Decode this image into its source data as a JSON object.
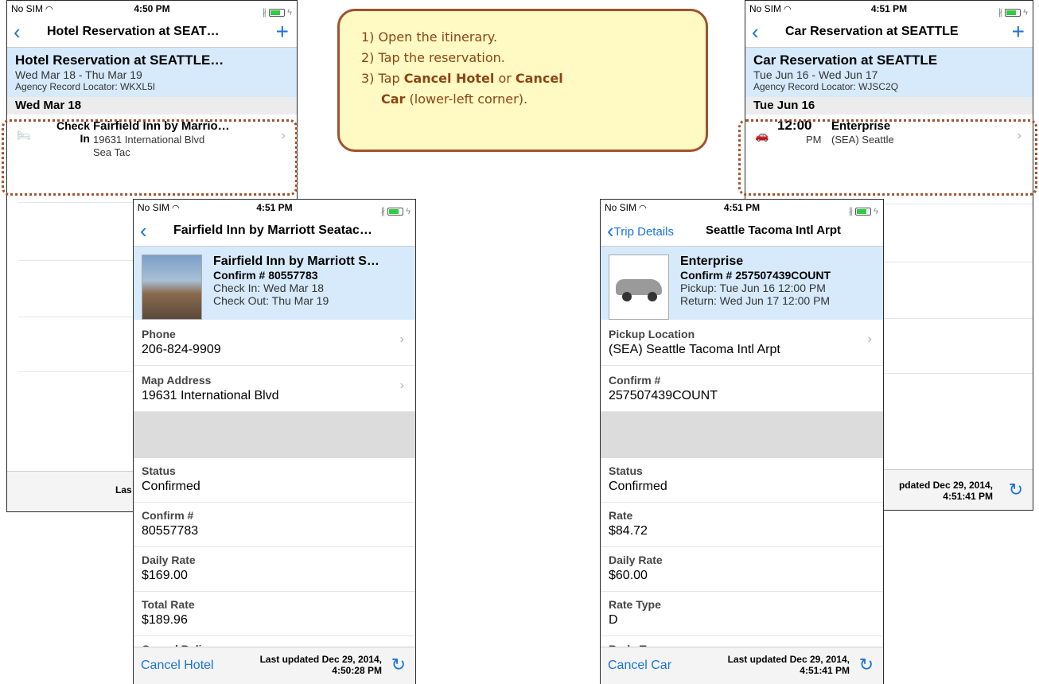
{
  "callout": {
    "step1": "1) Open the itinerary.",
    "step2": "2) Tap the reservation.",
    "step3_pre": "3) Tap ",
    "step3_b1": "Cancel Hotel",
    "step3_mid": " or ",
    "step3_b2": "Cancel",
    "step3_b2b": "Car",
    "step3_post": " (lower-left corner)."
  },
  "hotel_list": {
    "status": {
      "carrier": "No SIM",
      "time": "4:50 PM"
    },
    "nav_title": "Hotel Reservation at SEAT…",
    "header": {
      "title": "Hotel Reservation at SEATTLE…",
      "dates": "Wed Mar 18 - Thu Mar 19",
      "locator": "Agency Record Locator: WKXL5I"
    },
    "section": "Wed Mar 18",
    "row": {
      "label1": "Check",
      "label2": "In",
      "name": "Fairfield Inn by Marrio…",
      "addr1": "19631 International Blvd",
      "addr2": "Sea Tac"
    },
    "footer_partial": "Las"
  },
  "hotel_detail": {
    "status": {
      "carrier": "No SIM",
      "time": "4:51 PM"
    },
    "nav_title": "Fairfield Inn by Marriott Seatac…",
    "header": {
      "title": "Fairfield Inn by Marriott S…",
      "confirm": "Confirm # 80557783",
      "line1": "Check In: Wed Mar 18",
      "line2": "Check Out: Thu Mar 19"
    },
    "fields": [
      {
        "label": "Phone",
        "value": "206-824-9909"
      },
      {
        "label": "Map Address",
        "value": "19631 International Blvd"
      },
      {
        "label": "Status",
        "value": "Confirmed"
      },
      {
        "label": "Confirm #",
        "value": "80557783"
      },
      {
        "label": "Daily Rate",
        "value": "$169.00"
      },
      {
        "label": "Total Rate",
        "value": "$189.96"
      },
      {
        "label": "Cancel Policy",
        "value": ""
      }
    ],
    "footer": {
      "cancel": "Cancel Hotel",
      "updated1": "Last updated Dec 29, 2014,",
      "updated2": "4:50:28 PM"
    }
  },
  "car_list": {
    "status": {
      "carrier": "No SIM",
      "time": "4:51 PM"
    },
    "nav_title": "Car Reservation at SEATTLE",
    "header": {
      "title": "Car Reservation at SEATTLE",
      "dates": "Tue Jun 16 - Wed Jun 17",
      "locator": "Agency Record Locator: WJSC2Q"
    },
    "section": "Tue Jun 16",
    "row": {
      "time": "12:00",
      "ampm": "PM",
      "name": "Enterprise",
      "sub": "(SEA) Seattle"
    },
    "footer": {
      "updated1": "pdated Dec 29, 2014,",
      "updated2": "4:51:41 PM"
    }
  },
  "car_detail": {
    "status": {
      "carrier": "No SIM",
      "time": "4:51 PM"
    },
    "back": "Trip Details",
    "nav_title": "Seattle Tacoma Intl Arpt",
    "header": {
      "title": "Enterprise",
      "confirm": "Confirm # 257507439COUNT",
      "line1": "Pickup: Tue Jun 16 12:00 PM",
      "line2": "Return: Wed Jun 17 12:00 PM"
    },
    "fields": [
      {
        "label": "Pickup Location",
        "value": "(SEA) Seattle Tacoma Intl Arpt"
      },
      {
        "label": "Confirm #",
        "value": "257507439COUNT"
      },
      {
        "label": "Status",
        "value": "Confirmed"
      },
      {
        "label": "Rate",
        "value": "$84.72"
      },
      {
        "label": "Daily Rate",
        "value": "$60.00"
      },
      {
        "label": "Rate Type",
        "value": "D"
      },
      {
        "label": "Body Type",
        "value": ""
      }
    ],
    "footer": {
      "cancel": "Cancel Car",
      "updated1": "Last updated Dec 29, 2014,",
      "updated2": "4:51:41 PM"
    }
  },
  "colors": {
    "accent": "#1a73d9",
    "header_bg": "#d6eafb",
    "callout_bg": "#fff9c4",
    "callout_border": "#a0522d"
  }
}
